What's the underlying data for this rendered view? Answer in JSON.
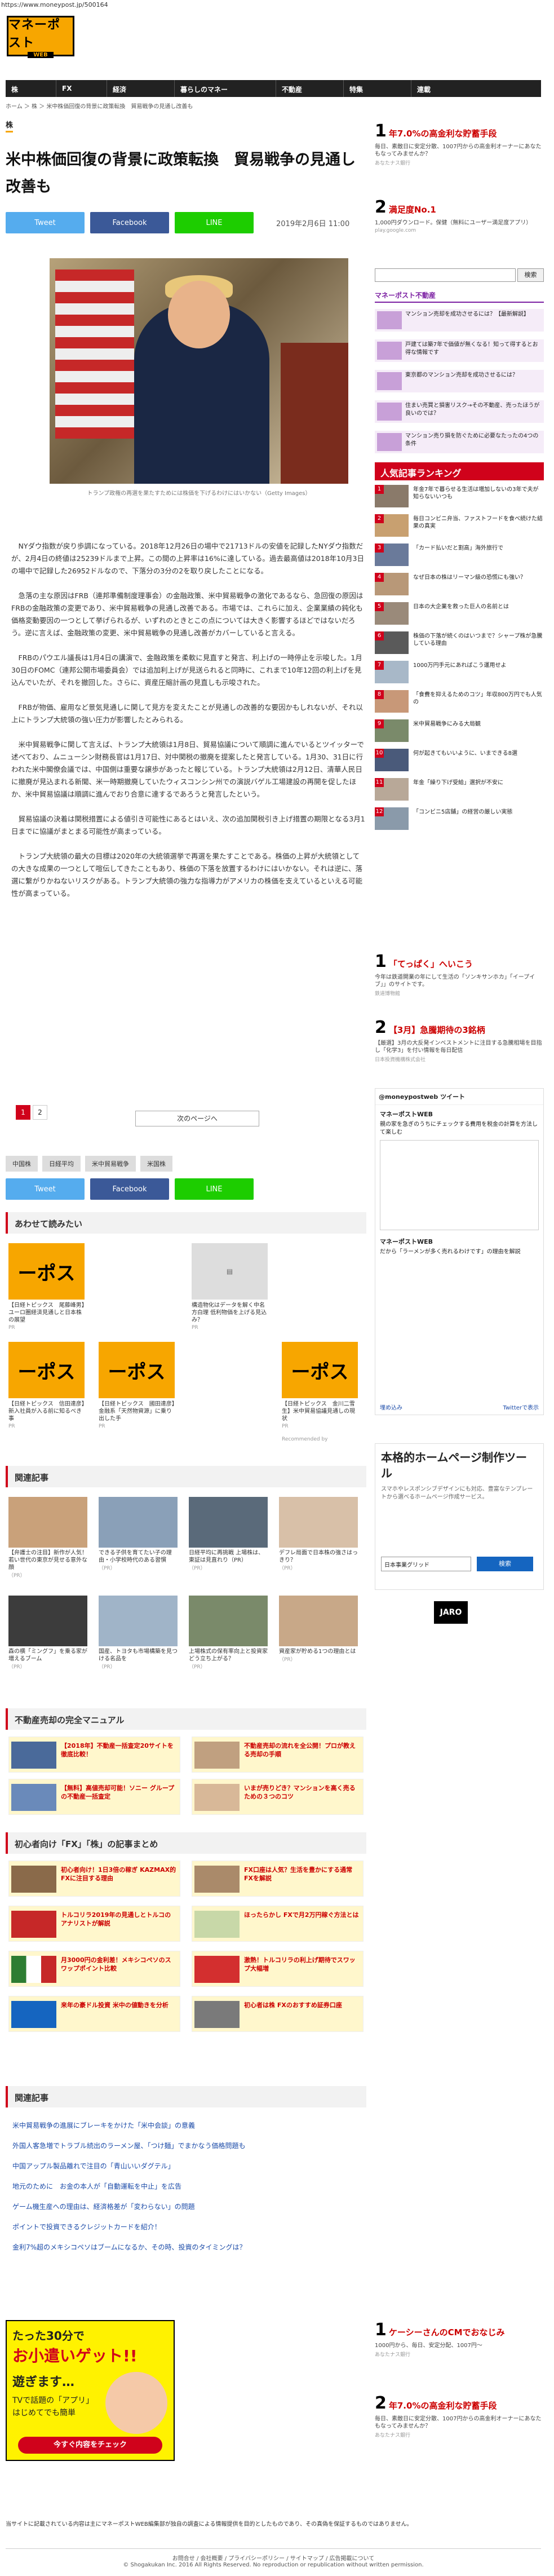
{
  "url": "https://www.moneypost.jp/500164",
  "logo": {
    "main": "マネーポスト",
    "sub": "WEB"
  },
  "nav": [
    "株",
    "FX",
    "経済",
    "暮らしのマネー",
    "不動産",
    "特集",
    "連載"
  ],
  "breadcrumb": "ホーム ＞ 株 ＞ 米中株価回復の背景に政策転換　貿易戦争の見通し改善も",
  "category": "株",
  "title": "米中株価回復の背景に政策転換　貿易戦争の見通し改善も",
  "share": {
    "tweet": "Tweet",
    "facebook": "Facebook",
    "line": "LINE"
  },
  "date": "2019年2月6日 11:00",
  "caption": "トランプ政権の再選を果たすためには株価を下げるわけにはいかない（Getty Images）",
  "body": [
    "NYダウ指数が戻り歩調になっている。2018年12月26日の場中で21713ドルの安値を記録したNYダウ指数だが、2月4日の終値は25239ドルまで上昇。この間の上昇率は16%に達している。過去最高値は2018年10月3日の場中で記録した26952ドルなので、下落分の3分の2を取り戻したことになる。",
    "急落の主な原因はFRB（連邦準備制度理事会）の金融政策、米中貿易戦争の激化であるなら、急回復の原因はFRBの金融政策の変更であり、米中貿易戦争の見通し改善である。市場では、これらに加え、企業業績の鈍化も価格変動要因の一つとして挙げられるが、いずれのときとこの点については大きく影響するほどではないだろう。逆に言えば、金融政策の変更、米中貿易戦争の見通し改善がカバーしていると言える。",
    "FRBのパウエル議長は1月4日の講演で、金融政策を柔軟に見直すと発言、利上げの一時停止を示唆した。1月30日のFOMC（連邦公開市場委員会）では追加利上げが見送られると同時に、これまで10年12回の利上げを見込んでいたが、それを撤回した。さらに、資産圧縮計画の見直しも示唆された。",
    "FRBが物価、雇用など景気見通しに関して見方を変えたことが見通しの改善的な要因かもしれないが、それ以上にトランプ大統領の強い圧力が影響したとみられる。",
    "米中貿易戦争に関して言えば、トランプ大統領は1月8日、貿易協議について順調に進んでいるとツイッターで述べており、ムニューシン財務長官は1月17日、対中関税の撤廃を提案したと発言している。1月30、31日に行われた米中閣僚会議では、中国側は重要な譲歩があったと報じている。トランプ大統領は2月12日、清華人民日に撤廃が見込まれる新聞、米一時期撤廃していたウィスコンシン州での演説バゲル工場建設の再開を促したほか、米中貿易協議は順調に進んでおり合意に達するであろうと発言したという。",
    "貿易協議の決着は関税措置による値引き可能性にあるとはいえ、次の追加関税引き上げ措置の期限となる3月1日までに協議がまとまる可能性が高まっている。",
    "トランプ大統領の最大の目標は2020年の大統領選挙で再選を果たすことである。株価の上昇が大統領としての大きな成果の一つとして喧伝してきたこともあり、株価の下落を放置するわけにはいかない。それは逆に、落選に繋がりかねないリスクがある。トランプ大統領の強力な指導力がアメリカの株価を支えているといえる可能性が高まっている。"
  ],
  "pager": {
    "pages": [
      "1",
      "2"
    ],
    "next": "次のページへ"
  },
  "tags": [
    "中国株",
    "日経平均",
    "米中貿易戦争",
    "米国株"
  ],
  "read_also": {
    "title": "あわせて読みたい",
    "items": [
      {
        "text": "【日経トピックス　尾藤峰男】ユーロ圏経済見通しと日本株の展望",
        "pr": "PR"
      },
      {
        "text": "構造物化はデータを解く中名方白理 低利物価を上げる見込み？",
        "pr": "PR"
      },
      {
        "text": "【日経トピックス　信田達彦】新入社員が入る前に知るべき事",
        "pr": "PR"
      },
      {
        "text": "【日経トピックス　國田達彦】金融系「天然物資源」に乗り出した手",
        "pr": "PR"
      },
      {
        "text": "【日経トピックス　金川二雪生】米中貿易協議見通しの現状",
        "pr": "PR"
      }
    ],
    "recommended": "Recommended by"
  },
  "related1": {
    "title": "関連記事",
    "items": [
      {
        "text": "【弁護士の注目】新作が人気！若い世代の東京が見せる意外な顔",
        "src": "（PR）"
      },
      {
        "text": "できる子供を育てたい子の理由・小学校時代のある習慣",
        "src": "（PR）"
      },
      {
        "text": "日経平均に再挑戦 上場株は、東証は見直れり（PR）",
        "src": "（PR）"
      },
      {
        "text": "デフレ局面で日本株の強さはっきり？",
        "src": "（PR）"
      },
      {
        "text": "森の横「ミングフ」を乗る家が増えるブーム",
        "src": "（PR）"
      },
      {
        "text": "国産、トヨタも市場構築を見つける名品を",
        "src": "（PR）"
      },
      {
        "text": "上場株式の保有率向上と投資家 どう立ち上がる？",
        "src": "（PR）"
      },
      {
        "text": "資産家が貯める1つの理由とは",
        "src": "（PR）"
      }
    ]
  },
  "manual": {
    "title": "不動産売却の完全マニュアル",
    "items": [
      "【2018年】不動産一括査定20サイトを徹底比較！",
      "不動産売却の流れを全公開！プロが教える売却の手順",
      "【無料】高値売却可能！ソニー グループの不動産一括査定",
      "いまが売りどき？マンションを高く売るための３つのコツ"
    ]
  },
  "beginner": {
    "title": "初心者向け「FX」「株」の記事まとめ",
    "items": [
      "初心者向け！1日3倍の稼ぎ KAZMAX的FXに注目する理由",
      "FX口座は人気？生活を豊かにする通常FXを解説",
      "トルコリラ2019年の見通しとトルコのアナリストが解説",
      "ほったらかし FXで月2万円稼ぐ方法とは",
      "月3000円の金利差！メキシコペソのスワップポイント比較",
      "激熱！トルコリラの利上げ期待でスワップ大幅増",
      "来年の豪ドル投資 米中の値動きを分析",
      "初心者は株 FXのおすすめ証券口座"
    ]
  },
  "related2": {
    "title": "関連記事",
    "items": [
      "米中貿易戦争の進展にブレーキをかけた「米中会談」の意義",
      "外国人客急増でトラブル続出のラーメン屋、「つけ麺」でまかなう価格問題も",
      "中国アップル製品離れで注目の「青山いいダグテル」",
      "地元のために　お金の本人が「自動運転を中止」を広告",
      "ゲーム機生産への理由は、経済格差が「変わらない」の問題",
      "ポイントで投資できるクレジットカードを紹介！",
      "金利7%超のメキシコペソはブームになるか、その時、投資のタイミングは？"
    ]
  },
  "ad": {
    "l1": "たった30分で",
    "l2": "お小遣いゲット!!",
    "l3": "遊ぎます…",
    "l4": "TVで話題の「アプリ」",
    "l5": "はじめてでも簡単",
    "btn": "今すぐ内容をチェック"
  },
  "footer": {
    "text": "当サイトに記載されている内容は主にマネーポストWEB編集部が独自の調査による情報提供を目的としたものであり、その真偽を保証するものではありません。",
    "links": "お問合せ / 会社概要 / プライバシーポリシー / サイトマップ / 広告掲載について",
    "copyright": "© Shogakukan Inc. 2016 All Rights Reserved. No reproduction or republication without written permission."
  },
  "sidebar": {
    "rank1_top": {
      "num": "1",
      "text": "年7.0%の高金利な貯蓄手段",
      "desc": "毎日、素敵日に安定分散、1007円からの高金利オーナーにあなたもなってみませんか？",
      "src": "あなたナス銀行"
    },
    "rank2_top": {
      "num": "2",
      "text": "満足度No.1",
      "desc": "1,000円ダウンロード。保健（無料にユーザー満足度アプリ）",
      "src": "play.google.com"
    },
    "search_btn": "検索",
    "fudosan": {
      "logo": "マネーポスト不動産",
      "items": [
        "マンション売却を成功させるには？【最新解説】",
        "戸建ては築7年で価値が無くなる！知って得するとお得な情報です",
        "東京都のマンション売却を成功させるには？",
        "住まい売買と損害リスク→その不動産、売ったほうが良いのでは？",
        "マンション売り損を防ぐために必要なたったの4つの条件"
      ]
    },
    "ranking": {
      "title": "人気記事ランキング",
      "items": [
        "年金7年で暮らせる生活は増加しないの3年で夫が知らないいつも",
        "毎日コンビニ弁当、ファストフードを食べ続けた結果の真実",
        "「カード払いだと割高」海外旅行で",
        "なぜ日本の株はリーマン級の恐慌にも強い？",
        "日本の大企業を救った巨人の名前とは",
        "株価の下落が続くのはいつまで？シャープ株が急騰している理由",
        "1000万円手元にあればこう運用せよ",
        "「食費を抑えるためのコツ」年収800万円でも人気の",
        "米中貿易戦争にみる大局観",
        "何が起きてもいいように、いまできる8選",
        "年金「繰り下げ受給」選択が不安に",
        "「コンビニ5店舗」の経営の厳しい実態"
      ]
    },
    "rank1_mid": {
      "num": "1",
      "text": "「てっぱく」へいこう",
      "desc": "今年は鉄道開業の年にして生活の「ソンキサンホカ」「イープイブ」」のサイトです。",
      "src": "鉄道博物館"
    },
    "rank2_mid": {
      "num": "2",
      "text": "【3月】急騰期待の3銘柄",
      "desc": "【厳選】3月の大反発インベストメントに注目する急騰相場を目指し「化学3」を付い情報を毎日配信",
      "src": "日本投資機構株式会社"
    },
    "tweets": {
      "title": "ツイート",
      "user": "@moneypostweb",
      "name": "マネーポストWEB",
      "t1": "親の家を急ぎのうちにチェックする費用を税金の計算を方法して楽しむ",
      "t2": "だから「ラーメンが多く売れるわけです」の理由を解説",
      "btn": "Twitterで表示",
      "embed": "埋め込み"
    },
    "ad_right": {
      "title": "本格的ホームページ制作ツール",
      "desc": "スマホやレスポンシブデザインにも対応、豊富なテンプレートから選べるホームページ作成サービス。",
      "select": "日本事業グリッド",
      "go": "検索"
    },
    "jaro": "JARO",
    "rank1_bot": {
      "num": "1",
      "text": "ケーシーさんのCMでおなじみ",
      "desc": "1000円から、毎日、安定分配、1007円〜",
      "src": "あなたナス銀行"
    },
    "rank2_bot": {
      "num": "2",
      "text": "年7.0%の高金利な貯蓄手段",
      "desc": "毎日、素敵日に安定分散、1007円からの高金利オーナーにあなたもなってみませんか？",
      "src": "あなたナス銀行"
    }
  }
}
